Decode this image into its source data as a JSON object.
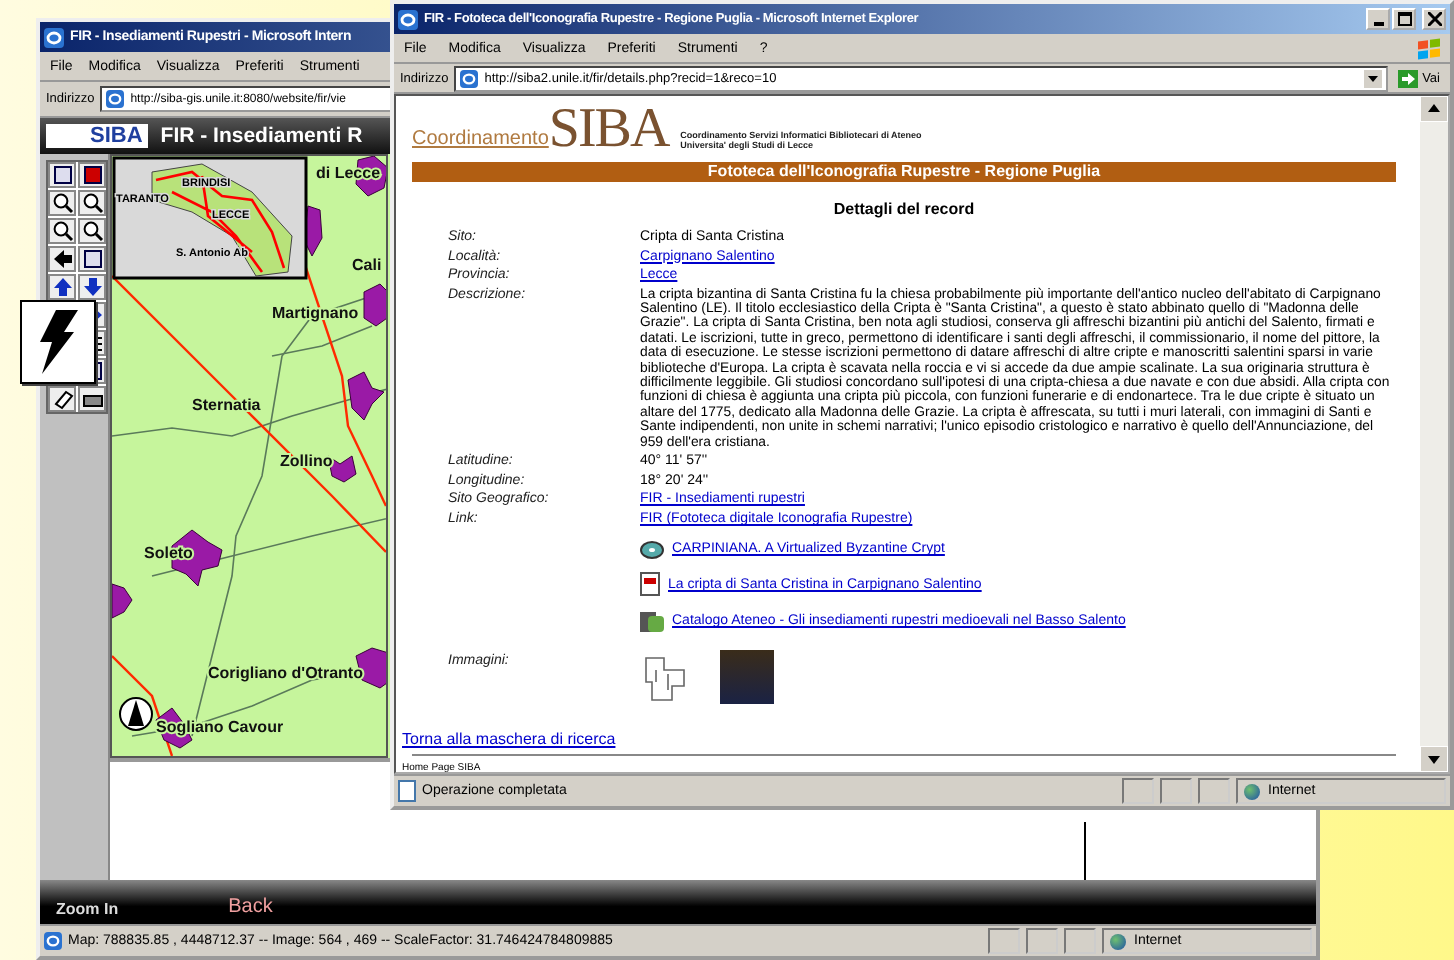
{
  "back_window": {
    "title": "FIR - Insediamenti Rupestri - Microsoft Intern",
    "menu": [
      "File",
      "Modifica",
      "Visualizza",
      "Preferiti",
      "Strumenti"
    ],
    "address_label": "Indirizzo",
    "address": "http://siba-gis.unile.it:8080/website/fir/vie",
    "logo": "SIBA",
    "banner_title": "FIR - Insediamenti R",
    "overview_labels": [
      "BRINDISI",
      "TARANTO",
      "LECCE",
      "S. Antonio Ab"
    ],
    "map_labels": [
      "di Lecce",
      "Cali",
      "Martignano",
      "Sternatia",
      "Zollino",
      "Soleto",
      "Corigliano d'Otranto",
      "Sogliano Cavour"
    ],
    "bottom_bar": {
      "tool": "Zoom In",
      "back": "Back"
    },
    "status_text": "Map: 788835.85 , 4448712.37 -- Image: 564 , 469 -- ScaleFactor: 31.746424784809885",
    "status_zone": "Internet"
  },
  "front_window": {
    "title": "FIR - Fototeca dell'Iconografia Rupestre - Regione Puglia - Microsoft Internet Explorer",
    "menu": [
      "File",
      "Modifica",
      "Visualizza",
      "Preferiti",
      "Strumenti",
      "?"
    ],
    "address_label": "Indirizzo",
    "address": "http://siba2.unile.it/fir/details.php?recid=1&reco=10",
    "go": "Vai",
    "logo": {
      "prefix": "Coordinamento",
      "name": "SIBA",
      "line1": "Coordinamento Servizi Informatici Bibliotecari di Ateneo",
      "line2": "Universita' degli Studi di Lecce"
    },
    "banner": "Fototeca dell'Iconografia Rupestre - Regione Puglia",
    "heading": "Dettagli del record",
    "fields": [
      {
        "label": "Sito:",
        "value": "Cripta di Santa Cristina",
        "kind": "text"
      },
      {
        "label": "Località:",
        "value": "Carpignano Salentino",
        "kind": "link"
      },
      {
        "label": "Provincia:",
        "value": "Lecce",
        "kind": "link"
      },
      {
        "label": "Descrizione:",
        "value": "La cripta bizantina di Santa Cristina fu la chiesa probabilmente più importante dell'antico nucleo dell'abitato di Carpignano Salentino (LE). Il titolo ecclesiastico della Cripta è \"Santa Cristina\", a questo è stato abbinato quello di \"Madonna delle Grazie\". La cripta di Santa Cristina, ben nota agli studiosi, conserva gli affreschi bizantini più antichi del Salento, firmati e datati. Le iscrizioni, tutte in greco, permettono di identificare i santi degli affreschi, il commissionario, il nome del pittore, la data di esecuzione. Le stesse iscrizioni permettono di datare affreschi di altre cripte e manoscritti salentini sparsi in varie biblioteche d'Europa. La cripta è scavata nella roccia e vi si accede da due ampie scalinate. La sua originaria struttura è difficilmente leggibile. Gli studiosi concordano sull'ipotesi di una cripta-chiesa a due navate e con due absidi. Alla cripta con funzioni di chiesa è aggiunta una cripta più piccola, con funzioni funerarie e di endonartece. Tra le due cripte è situato un altare del 1775, dedicato alla Madonna delle Grazie. La cripta è affrescata, su tutti i muri laterali, con immagini di Santi e Sante indipendenti, non unite in schemi narrativi; l'unico episodio cristologico e narrativo è quello dell'Annunciazione, del 959 dell'era cristiana.",
        "kind": "paragraph"
      },
      {
        "label": "Latitudine:",
        "value": "40° 11' 57''",
        "kind": "text"
      },
      {
        "label": "Longitudine:",
        "value": "18° 20' 24''",
        "kind": "text"
      },
      {
        "label": "Sito Geografico:",
        "value": "FIR - Insediamenti rupestri",
        "kind": "link"
      },
      {
        "label": "Link:",
        "value": "FIR (Fototeca digitale Iconografia Rupestre)",
        "kind": "link"
      }
    ],
    "links": [
      {
        "text": "CARPINIANA. A Virtualized Byzantine Crypt",
        "kind": "disc"
      },
      {
        "text": "La cripta di Santa Cristina in Carpignano Salentino",
        "kind": "pdf"
      },
      {
        "text": "Catalogo Ateneo - Gli insediamenti rupestri medioevali nel Basso Salento",
        "kind": "books"
      }
    ],
    "images_label": "Immagini:",
    "images": [
      {
        "kind": "plan"
      },
      {
        "kind": "photo"
      }
    ],
    "back_link": "Torna alla maschera di ricerca",
    "footer": "Home Page SIBA",
    "status_text": "Operazione completata",
    "status_zone": "Internet"
  }
}
